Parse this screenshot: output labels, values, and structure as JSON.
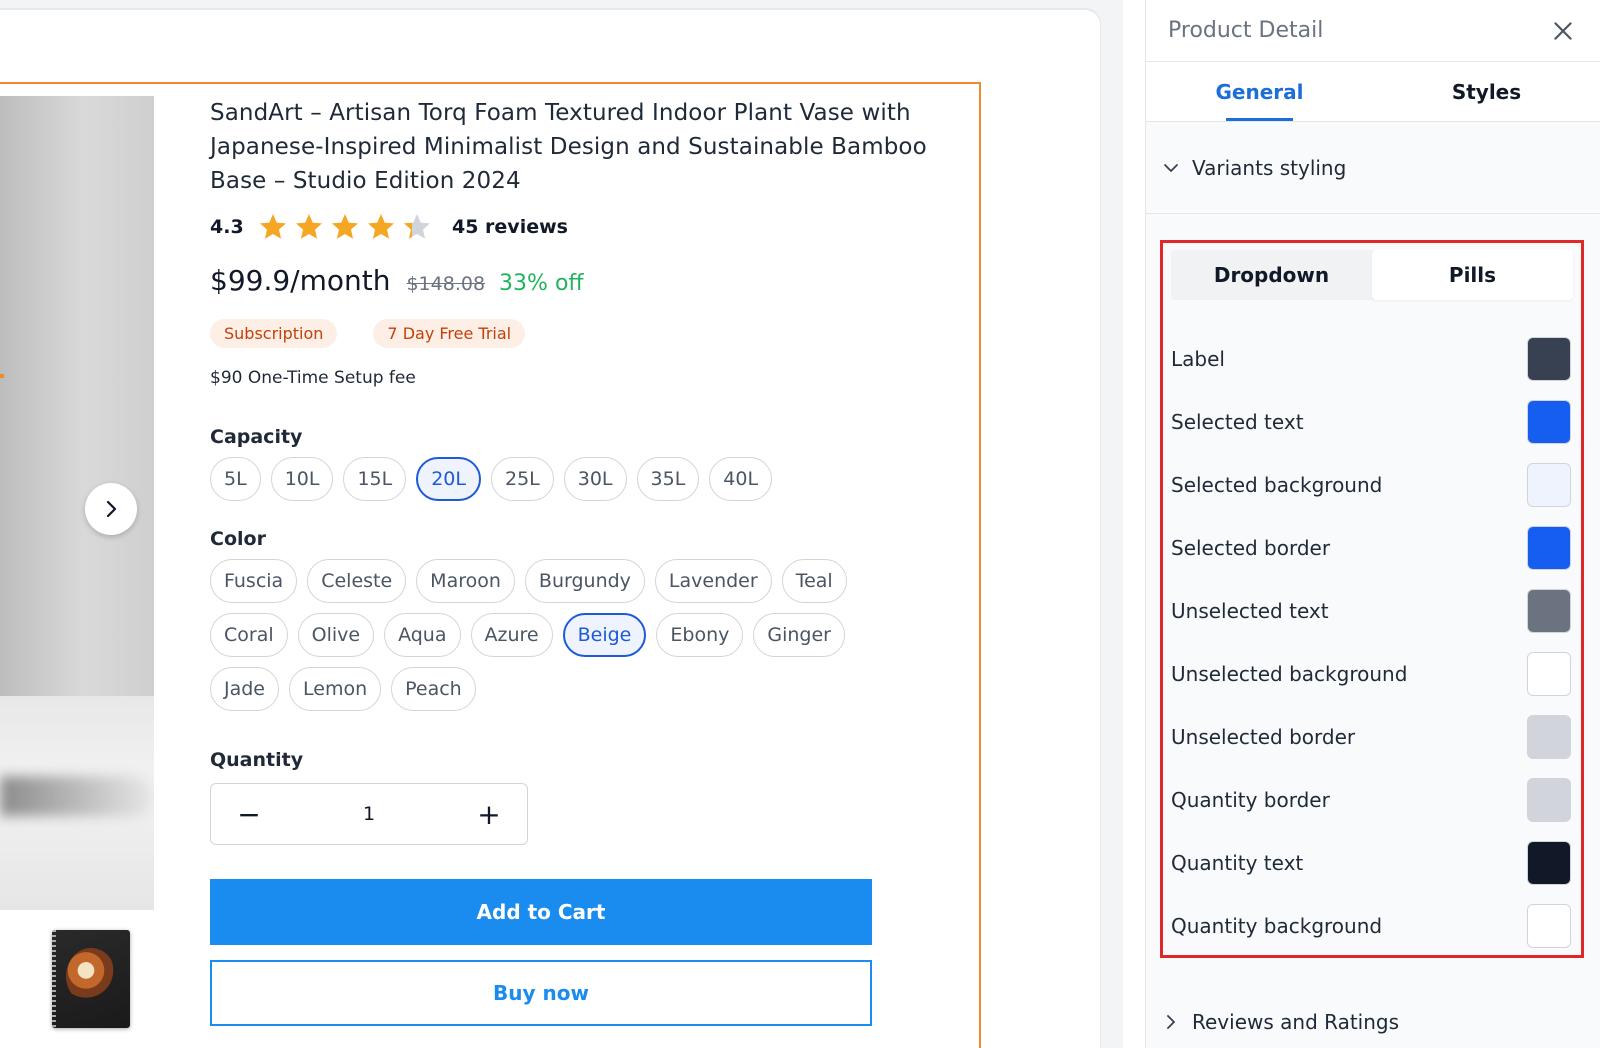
{
  "product": {
    "title": "SandArt – Artisan Torq Foam Textured Indoor Plant Vase with Japanese-Inspired Minimalist Design and Sustainable Bamboo Base – Studio Edition 2024",
    "rating": "4.3",
    "rating_value": 4.3,
    "rating_max": 5,
    "reviews": "45 reviews",
    "price": "$99.9/month",
    "old_price": "$148.08",
    "discount": "33% off",
    "badges": [
      "Subscription",
      "7 Day Free Trial"
    ],
    "setup_fee": "$90 One-Time Setup fee",
    "capacity_label": "Capacity",
    "capacities": [
      "5L",
      "10L",
      "15L",
      "20L",
      "25L",
      "30L",
      "35L",
      "40L"
    ],
    "capacity_selected": "20L",
    "color_label": "Color",
    "colors": [
      "Fuscia",
      "Celeste",
      "Maroon",
      "Burgundy",
      "Lavender",
      "Teal",
      "Coral",
      "Olive",
      "Aqua",
      "Azure",
      "Beige",
      "Ebony",
      "Ginger",
      "Jade",
      "Lemon",
      "Peach"
    ],
    "color_selected": "Beige",
    "quantity_label": "Quantity",
    "quantity": "1",
    "qty_minus": "−",
    "qty_plus": "+",
    "add_to_cart": "Add to Cart",
    "buy_now": "Buy now",
    "star_color": "#f5a623",
    "icons": {
      "next": "chevron-right-icon",
      "star": "star-icon"
    }
  },
  "panel": {
    "title": "Product Detail",
    "tabs": [
      "General",
      "Styles"
    ],
    "active_tab": "General",
    "section_variants": "Variants styling",
    "segments": [
      "Dropdown",
      "Pills"
    ],
    "active_segment": "Dropdown",
    "color_settings": [
      {
        "label": "Label",
        "color": "#374151"
      },
      {
        "label": "Selected text",
        "color": "#155eef"
      },
      {
        "label": "Selected background",
        "color": "#eef3fe"
      },
      {
        "label": "Selected border",
        "color": "#155eef"
      },
      {
        "label": "Unselected text",
        "color": "#6b7280"
      },
      {
        "label": "Unselected background",
        "color": "#ffffff"
      },
      {
        "label": "Unselected border",
        "color": "#d1d5db"
      },
      {
        "label": "Quantity border",
        "color": "#d1d5db"
      },
      {
        "label": "Quantity text",
        "color": "#111827"
      },
      {
        "label": "Quantity background",
        "color": "#ffffff"
      }
    ],
    "section_reviews": "Reviews and Ratings"
  },
  "colors": {
    "accent": "#1a8cf0",
    "selection_frame": "#f28a2b",
    "highlight_box": "#e02828",
    "discount": "#22b35e"
  }
}
